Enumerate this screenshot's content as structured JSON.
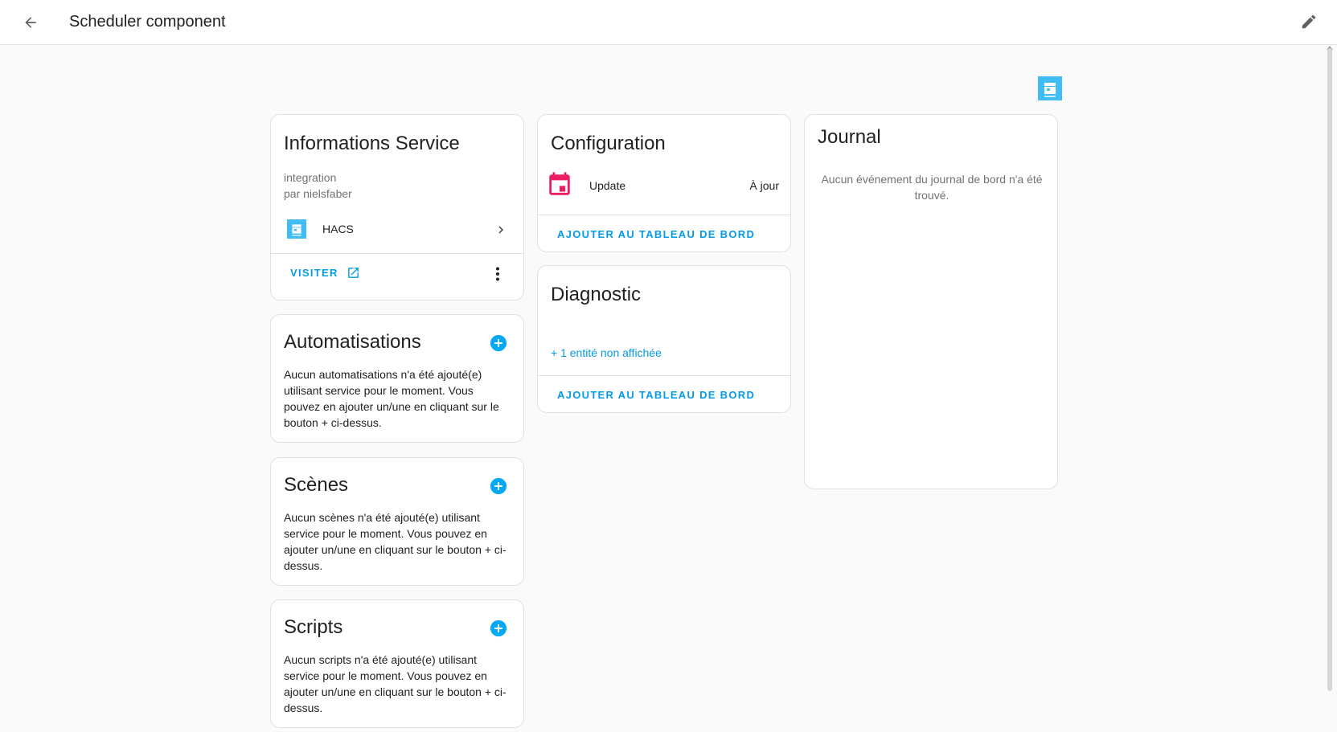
{
  "header": {
    "title": "Scheduler component",
    "back_icon": "arrow-left-icon",
    "edit_icon": "pencil-icon"
  },
  "brand_logo": {
    "icon": "hacs-logo-icon",
    "color": "#41bdf5"
  },
  "info_card": {
    "title": "Informations Service",
    "type_line": "integration",
    "author_line": "par nielsfaber",
    "hacs_label": "HACS",
    "visit_label": "VISITER"
  },
  "automations_card": {
    "title": "Automatisations",
    "body": "Aucun automatisations n'a été ajouté(e) utilisant service pour le moment. Vous pouvez en ajouter un/une en cliquant sur le bouton + ci-dessus."
  },
  "scenes_card": {
    "title": "Scènes",
    "body": "Aucun scènes n'a été ajouté(e) utilisant service pour le moment. Vous pouvez en ajouter un/une en cliquant sur le bouton + ci-dessus."
  },
  "scripts_card": {
    "title": "Scripts",
    "body": "Aucun scripts n'a été ajouté(e) utilisant service pour le moment. Vous pouvez en ajouter un/une en cliquant sur le bouton + ci-dessus."
  },
  "configuration_card": {
    "title": "Configuration",
    "entity_name": "Update",
    "entity_state": "À jour",
    "action_label": "AJOUTER AU TABLEAU DE BORD",
    "entity_icon_color": "#e91e63"
  },
  "diagnostic_card": {
    "title": "Diagnostic",
    "hidden_entities_label": "+ 1 entité non affichée",
    "action_label": "AJOUTER AU TABLEAU DE BORD"
  },
  "journal_card": {
    "title": "Journal",
    "empty_text": "Aucun événement du journal de bord n'a été trouvé."
  },
  "colors": {
    "accent": "#039be5",
    "plus_button": "#03a9f4"
  }
}
